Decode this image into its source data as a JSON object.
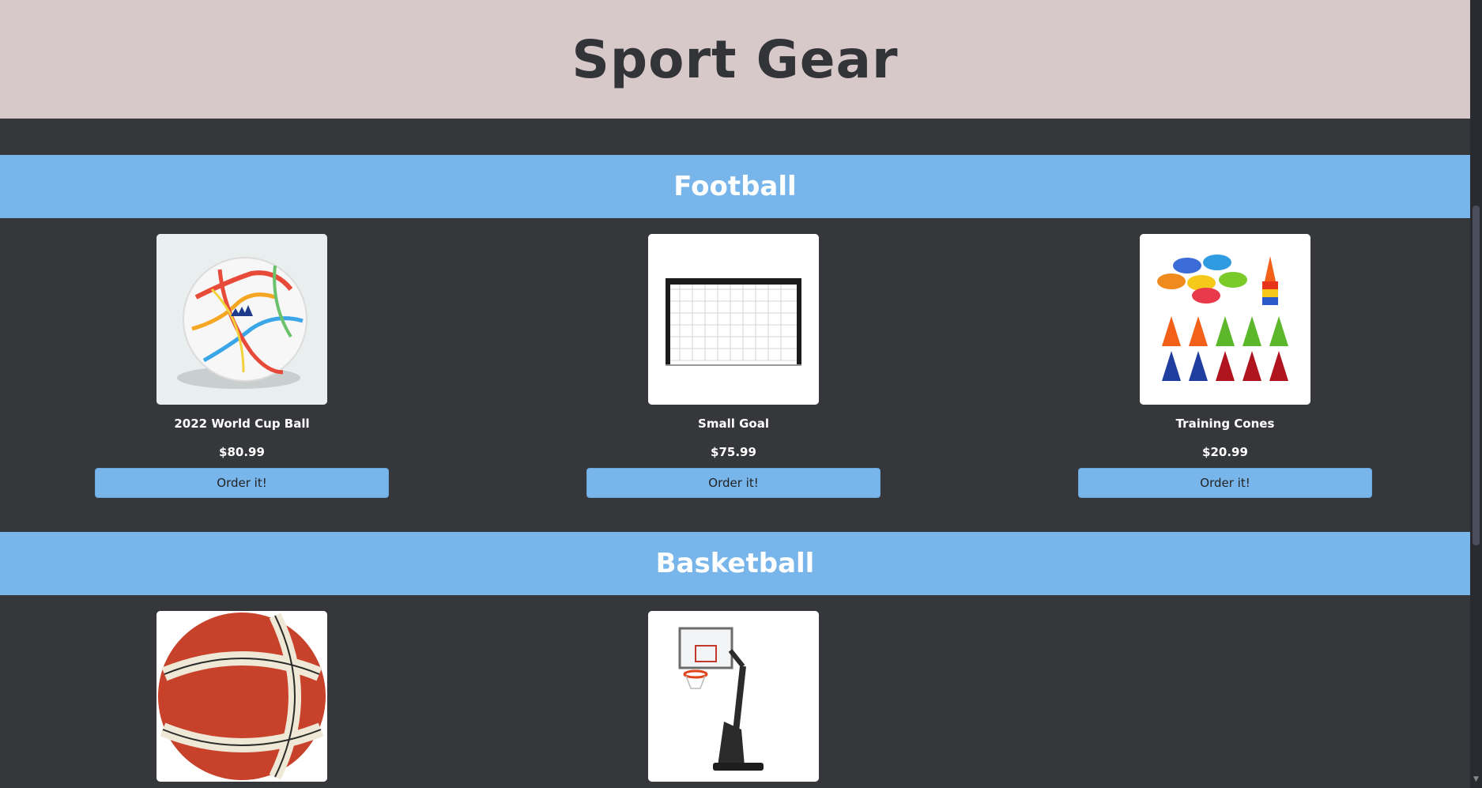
{
  "header": {
    "title": "Sport Gear"
  },
  "sections": [
    {
      "title": "Football",
      "products": [
        {
          "name": "2022 World Cup Ball",
          "price": "$80.99",
          "button": "Order it!",
          "image_icon": "soccer-ball-image"
        },
        {
          "name": "Small Goal",
          "price": "$75.99",
          "button": "Order it!",
          "image_icon": "goal-image"
        },
        {
          "name": "Training Cones",
          "price": "$20.99",
          "button": "Order it!",
          "image_icon": "cones-image"
        }
      ]
    },
    {
      "title": "Basketball",
      "products": [
        {
          "image_icon": "basketball-image"
        },
        {
          "image_icon": "basketball-hoop-image"
        }
      ]
    }
  ],
  "colors": {
    "background": "#36373a",
    "header_bg": "#d7c9ca",
    "accent": "#78b5ea",
    "title_text": "#333437"
  }
}
